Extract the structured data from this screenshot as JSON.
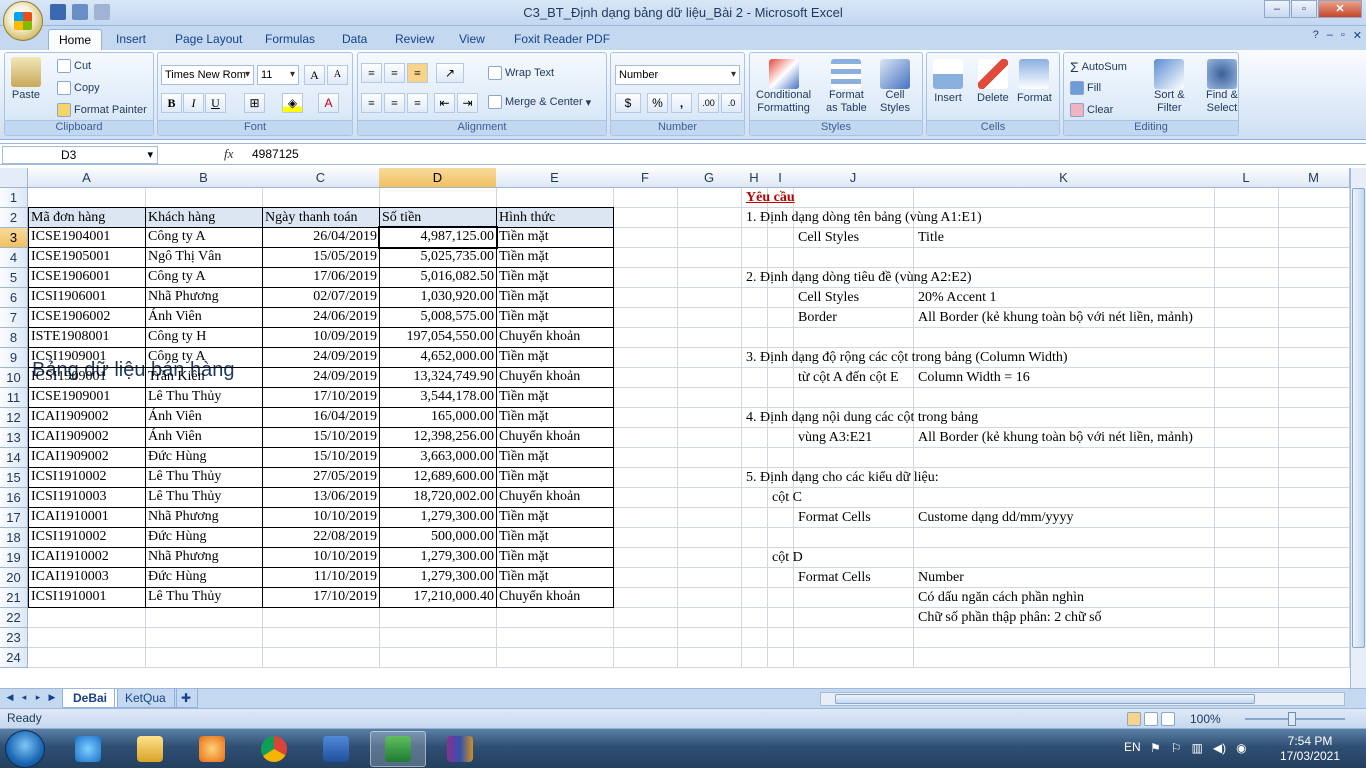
{
  "window": {
    "title": "C3_BT_Định dạng bảng dữ liệu_Bài 2 - Microsoft Excel",
    "min": "–",
    "max": "▫",
    "close": "✕"
  },
  "tabs": [
    "Home",
    "Insert",
    "Page Layout",
    "Formulas",
    "Data",
    "Review",
    "View",
    "Foxit Reader PDF"
  ],
  "ribbon_help": {
    "help": "?",
    "min": "–",
    "restore": "▫",
    "close": "✕"
  },
  "ribbon": {
    "clipboard": {
      "label": "Clipboard",
      "paste": "Paste",
      "cut": "Cut",
      "copy": "Copy",
      "format_painter": "Format Painter"
    },
    "font": {
      "label": "Font",
      "name": "Times New Rom",
      "size": "11",
      "bold": "B",
      "italic": "I",
      "underline": "U",
      "grow": "A",
      "shrink": "A"
    },
    "alignment": {
      "label": "Alignment",
      "wrap_text": "Wrap Text",
      "merge_center": "Merge & Center"
    },
    "number": {
      "label": "Number",
      "format": "Number",
      "currency": "$",
      "percent": "%",
      "comma": ",",
      "inc_dec": ".00",
      "dec_dec": ".0"
    },
    "styles": {
      "label": "Styles",
      "conditional": "Conditional",
      "conditional2": "Formatting",
      "format_table": "Format",
      "format_table2": "as Table",
      "cell_styles": "Cell",
      "cell_styles2": "Styles"
    },
    "cells": {
      "label": "Cells",
      "insert": "Insert",
      "delete": "Delete",
      "format": "Format"
    },
    "editing": {
      "label": "Editing",
      "autosum": "AutoSum",
      "fill": "Fill",
      "clear": "Clear",
      "sort": "Sort &",
      "sort2": "Filter",
      "find": "Find &",
      "find2": "Select"
    }
  },
  "formula_bar": {
    "name_box": "D3",
    "fx": "fx",
    "value": "4987125"
  },
  "columns": [
    "A",
    "B",
    "C",
    "D",
    "E",
    "F",
    "G",
    "H",
    "I",
    "J",
    "K",
    "L",
    "M"
  ],
  "rows": [
    "1",
    "2",
    "3",
    "4",
    "5",
    "6",
    "7",
    "8",
    "9",
    "10",
    "11",
    "12",
    "13",
    "14",
    "15",
    "16",
    "17",
    "18",
    "19",
    "20",
    "21",
    "22",
    "23",
    "24"
  ],
  "sheet": {
    "title": "Bảng dữ liệu bán hàng",
    "headers": [
      "Mã đơn hàng",
      "Khách hàng",
      "Ngày thanh toán",
      "Số tiền",
      "Hình thức"
    ],
    "rows": [
      [
        "ICSE1904001",
        "Công ty A",
        "26/04/2019",
        "4,987,125.00",
        "Tiền mặt"
      ],
      [
        "ICSE1905001",
        "Ngô Thị Vân",
        "15/05/2019",
        "5,025,735.00",
        "Tiền mặt"
      ],
      [
        "ICSE1906001",
        "Công ty A",
        "17/06/2019",
        "5,016,082.50",
        "Tiền mặt"
      ],
      [
        "ICSI1906001",
        "Nhã Phương",
        "02/07/2019",
        "1,030,920.00",
        "Tiền mặt"
      ],
      [
        "ICSE1906002",
        "Ánh Viên",
        "24/06/2019",
        "5,008,575.00",
        "Tiền mặt"
      ],
      [
        "ISTE1908001",
        "Công ty H",
        "10/09/2019",
        "197,054,550.00",
        "Chuyển khoản"
      ],
      [
        "ICSI1909001",
        "Công ty A",
        "24/09/2019",
        "4,652,000.00",
        "Tiền mặt"
      ],
      [
        "ICSI1909001",
        "Trần Kiên",
        "24/09/2019",
        "13,324,749.90",
        "Chuyển khoản"
      ],
      [
        "ICSE1909001",
        "Lê Thu Thủy",
        "17/10/2019",
        "3,544,178.00",
        "Tiền mặt"
      ],
      [
        "ICAI1909002",
        "Ánh Viên",
        "16/04/2019",
        "165,000.00",
        "Tiền mặt"
      ],
      [
        "ICAI1909002",
        "Ánh Viên",
        "15/10/2019",
        "12,398,256.00",
        "Chuyển khoản"
      ],
      [
        "ICAI1909002",
        "Đức Hùng",
        "15/10/2019",
        "3,663,000.00",
        "Tiền mặt"
      ],
      [
        "ICSI1910002",
        "Lê Thu Thủy",
        "27/05/2019",
        "12,689,600.00",
        "Tiền mặt"
      ],
      [
        "ICSI1910003",
        "Lê Thu Thủy",
        "13/06/2019",
        "18,720,002.00",
        "Chuyển khoản"
      ],
      [
        "ICAI1910001",
        "Nhã Phương",
        "10/10/2019",
        "1,279,300.00",
        "Tiền mặt"
      ],
      [
        "ICSI1910002",
        "Đức Hùng",
        "22/08/2019",
        "500,000.00",
        "Tiền mặt"
      ],
      [
        "ICAI1910002",
        "Nhã Phương",
        "10/10/2019",
        "1,279,300.00",
        "Tiền mặt"
      ],
      [
        "ICAI1910003",
        "Đức Hùng",
        "11/10/2019",
        "1,279,300.00",
        "Tiền mặt"
      ],
      [
        "ICSI1910001",
        "Lê Thu Thủy",
        "17/10/2019",
        "17,210,000.40",
        "Chuyển khoản"
      ]
    ]
  },
  "requirements": {
    "heading": "Yêu cầu",
    "r1": "1. Định dạng dòng tên bảng (vùng A1:E1)",
    "r1a_label": "Cell Styles",
    "r1a_value": "Title",
    "r2": "2. Định dạng dòng tiêu đề (vùng A2:E2)",
    "r2a_label": "Cell Styles",
    "r2a_value": "20% Accent 1",
    "r2b_label": "Border",
    "r2b_value": "All Border (kẻ khung toàn bộ với nét liền, mảnh)",
    "r3": "3. Định dạng độ rộng các cột trong bảng (Column Width)",
    "r3a_label": "từ cột A đến cột E",
    "r3a_value": "Column Width = 16",
    "r4": "4. Định dạng nội dung các cột trong bảng",
    "r4a_label": "vùng A3:E21",
    "r4a_value": "All Border (kẻ khung toàn bộ với nét liền, mảnh)",
    "r5": "5. Định dạng cho các kiểu dữ liệu:",
    "r5c": "cột C",
    "r5c_label": "Format Cells",
    "r5c_value": "Custome dạng dd/mm/yyyy",
    "r5d": "cột D",
    "r5d_label": "Format Cells",
    "r5d_value": "Number",
    "r5d_v2": "Có dấu ngăn cách phần nghìn",
    "r5d_v3": "Chữ số phần thập phân: 2 chữ số"
  },
  "sheet_tabs": [
    "DeBai",
    "KetQua"
  ],
  "status": {
    "text": "Ready",
    "zoom": "100%"
  },
  "taskbar": {
    "lang": "EN",
    "time": "7:54 PM",
    "date": "17/03/2021"
  },
  "colors": {
    "header_fill": "#dce6f2",
    "req_heading": "#c00000",
    "title_text": "#1f3a5f"
  }
}
